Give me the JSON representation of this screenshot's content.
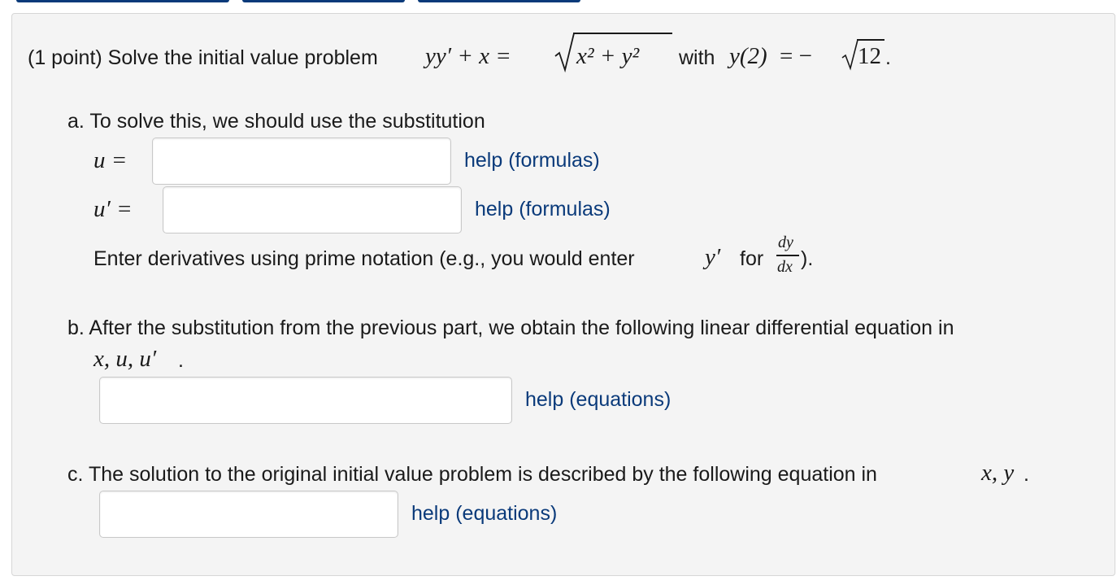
{
  "problem": {
    "prefix": "(1 point) Solve the initial value problem ",
    "equation_lhs": "yy′ + x =",
    "equation_rhs_radicand": "x² + y²",
    "with_word": "with",
    "initial_condition_lhs": "y(2)",
    "initial_condition_eq": "= −",
    "initial_condition_value": "12",
    "end_period": "."
  },
  "part_a": {
    "intro": "a. To solve this, we should use the substitution",
    "u_label": "u =",
    "u_value": "",
    "u_help": "help (formulas)",
    "uprime_label": "u′ =",
    "uprime_value": "",
    "uprime_help": "help (formulas)",
    "note_prefix": "Enter derivatives using prime notation (e.g., you would enter",
    "note_symbol": "y′",
    "note_for": "for",
    "note_frac_num": "dy",
    "note_frac_den": "dx",
    "note_suffix": ")."
  },
  "part_b": {
    "intro": "b. After the substitution from the previous part, we obtain the following linear differential equation in",
    "variables": "x, u, u′",
    "end_period": ".",
    "answer_value": "",
    "help": "help (equations)"
  },
  "part_c": {
    "intro": "c. The solution to the original initial value problem is described by the following equation in",
    "variables": "x, y",
    "end_period": ".",
    "answer_value": "",
    "help": "help (equations)"
  }
}
